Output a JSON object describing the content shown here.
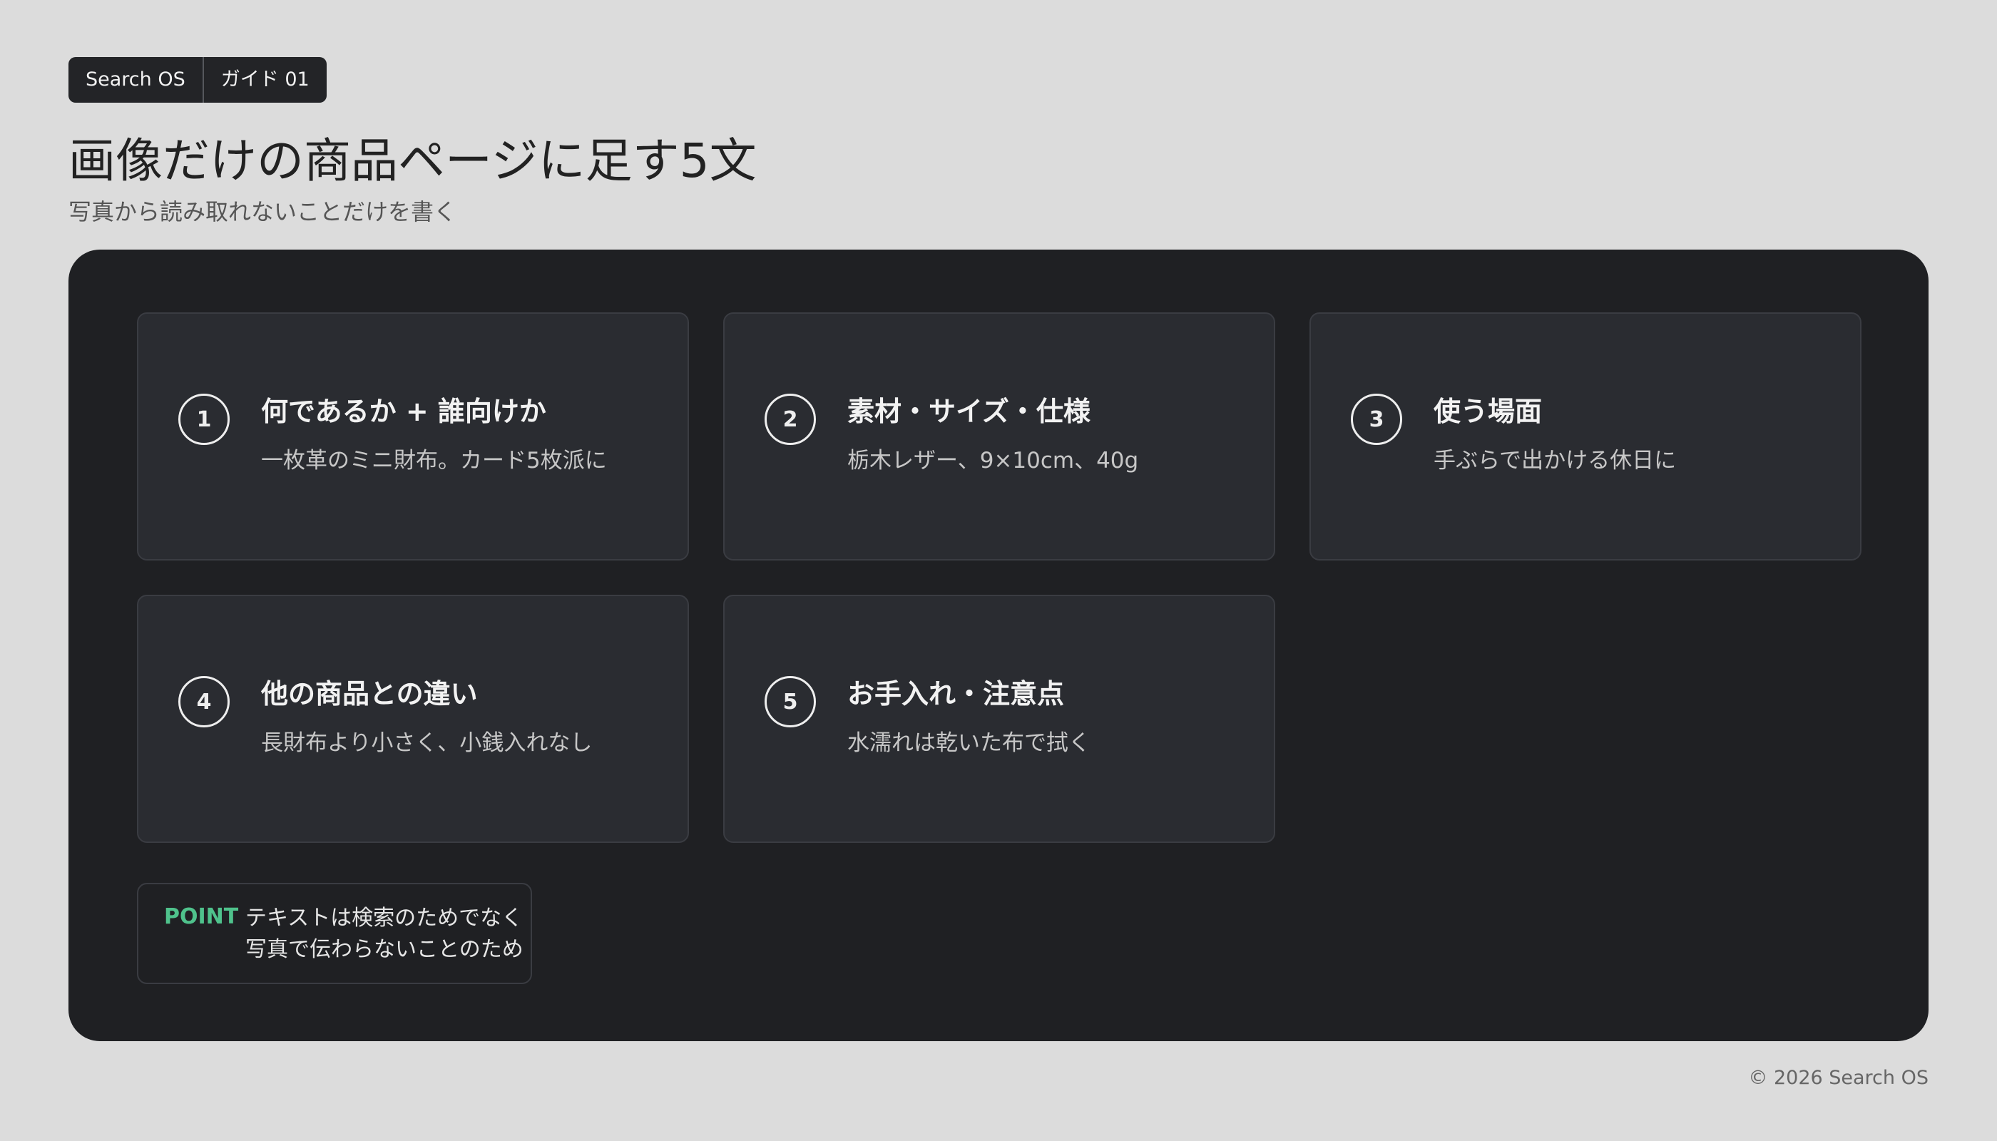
{
  "breadcrumb": [
    "Search OS",
    "ガイド 01"
  ],
  "header": {
    "title": "画像だけの商品ページに足す5文",
    "subtitle": "写真から読み取れないことだけを書く"
  },
  "cards": [
    {
      "num": "1",
      "title": "何であるか + 誰向けか",
      "desc": "一枚革のミニ財布。カード5枚派に"
    },
    {
      "num": "2",
      "title": "素材・サイズ・仕様",
      "desc": "栃木レザー、9×10cm、40g"
    },
    {
      "num": "3",
      "title": "使う場面",
      "desc": "手ぶらで出かける休日に"
    },
    {
      "num": "4",
      "title": "他の商品との違い",
      "desc": "長財布より小さく、小銭入れなし"
    },
    {
      "num": "5",
      "title": "お手入れ・注意点",
      "desc": "水濡れは乾いた布で拭く"
    }
  ],
  "point": {
    "label": "POINT",
    "line1": "テキストは検索のためでなく",
    "line2": "写真で伝わらないことのため"
  },
  "footer": "© 2026 Search OS",
  "colors": {
    "background": "#dcdcdc",
    "panel": "#1f2023",
    "card": "#2a2c31",
    "accent": "#4fc28c"
  }
}
